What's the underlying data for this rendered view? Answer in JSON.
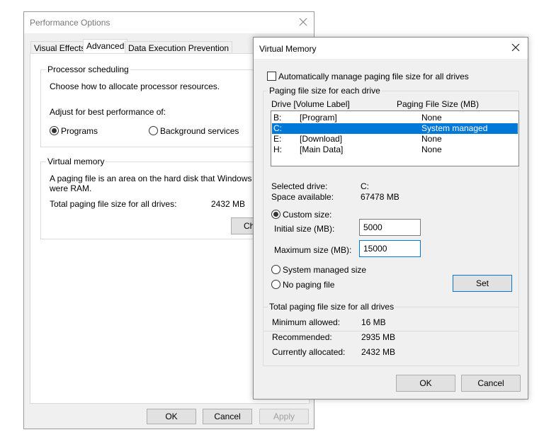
{
  "performance": {
    "title": "Performance Options",
    "tabs": [
      {
        "label": "Visual Effects"
      },
      {
        "label": "Advanced"
      },
      {
        "label": "Data Execution Prevention"
      }
    ],
    "processor": {
      "legend": "Processor scheduling",
      "description": "Choose how to allocate processor resources.",
      "adjust_label": "Adjust for best performance of:",
      "options": [
        {
          "label": "Programs",
          "selected": true
        },
        {
          "label": "Background services",
          "selected": false
        }
      ]
    },
    "virtual_memory": {
      "legend": "Virtual memory",
      "description_line1": "A paging file is an area on the hard disk that Windows us",
      "description_line2": "were RAM.",
      "total_label": "Total paging file size for all drives:",
      "total_value": "2432 MB",
      "change_button": "Ch"
    },
    "buttons": {
      "ok": "OK",
      "cancel": "Cancel",
      "apply": "Apply"
    }
  },
  "virtual_memory_dialog": {
    "title": "Virtual Memory",
    "auto_manage": {
      "label": "Automatically manage paging file size for all drives",
      "checked": false
    },
    "paging_group": {
      "legend": "Paging file size for each drive",
      "col_drive": "Drive  [Volume Label]",
      "col_size": "Paging File Size (MB)",
      "rows": [
        {
          "drive": "B:",
          "label": "[Program]",
          "size": "None",
          "selected": false
        },
        {
          "drive": "C:",
          "label": "",
          "size": "System managed",
          "selected": true
        },
        {
          "drive": "E:",
          "label": "[Download]",
          "size": "None",
          "selected": false
        },
        {
          "drive": "H:",
          "label": "[Main Data]",
          "size": "None",
          "selected": false
        }
      ]
    },
    "selected_drive_label": "Selected drive:",
    "selected_drive_value": "C:",
    "space_available_label": "Space available:",
    "space_available_value": "67478 MB",
    "custom_size": {
      "label": "Custom size:",
      "selected": true
    },
    "initial_size": {
      "label": "Initial size (MB):",
      "value": "5000"
    },
    "maximum_size": {
      "label": "Maximum size (MB):",
      "value": "15000"
    },
    "system_managed": {
      "label": "System managed size",
      "selected": false
    },
    "no_paging": {
      "label": "No paging file",
      "selected": false
    },
    "set_button": "Set",
    "totals": {
      "legend": "Total paging file size for all drives",
      "minimum_label": "Minimum allowed:",
      "minimum_value": "16 MB",
      "recommended_label": "Recommended:",
      "recommended_value": "2935 MB",
      "current_label": "Currently allocated:",
      "current_value": "2432 MB"
    },
    "buttons": {
      "ok": "OK",
      "cancel": "Cancel"
    }
  },
  "colors": {
    "accent": "#0078d7",
    "window_bg": "#f0f0f0",
    "border": "#adadad"
  }
}
